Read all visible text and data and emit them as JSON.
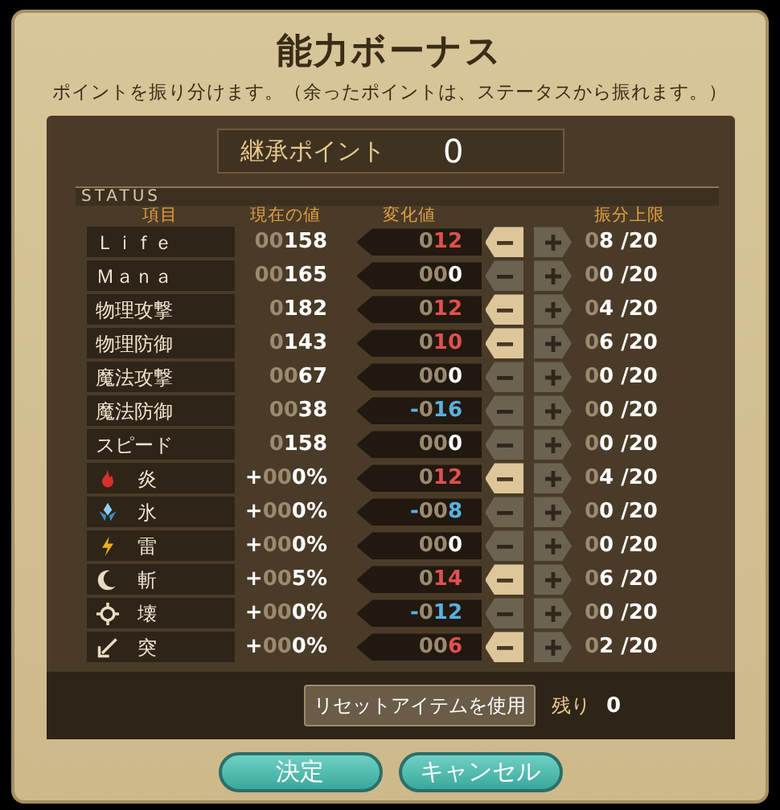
{
  "window": {
    "title": "能力ボーナス",
    "subtitle": "ポイントを振り分けます。（余ったポイントは、ステータスから振れます。）"
  },
  "inherit": {
    "label": "継承ポイント",
    "value": "0"
  },
  "section": "STATUS",
  "columns": [
    "項目",
    "現在の値",
    "変化値",
    "振分上限"
  ],
  "rows": [
    {
      "kind": "stat",
      "label": "Ｌｉｆｅ",
      "current_pad": "00",
      "current": "158",
      "change_sign": "",
      "change_pad": "0",
      "change": "12",
      "color": "#e05050",
      "minus_enabled": true,
      "limit_pad": "0",
      "limit": "8",
      "limit_max": "/20"
    },
    {
      "kind": "stat",
      "label": "Ｍａｎａ",
      "current_pad": "00",
      "current": "165",
      "change_sign": "",
      "change_pad": "00",
      "change": "0",
      "color": "#ffffff",
      "minus_enabled": false,
      "limit_pad": "0",
      "limit": "0",
      "limit_max": "/20"
    },
    {
      "kind": "stat",
      "label": "物理攻撃",
      "current_pad": "0",
      "current": "182",
      "change_sign": "",
      "change_pad": "0",
      "change": "12",
      "color": "#e05050",
      "minus_enabled": true,
      "limit_pad": "0",
      "limit": "4",
      "limit_max": "/20"
    },
    {
      "kind": "stat",
      "label": "物理防御",
      "current_pad": "0",
      "current": "143",
      "change_sign": "",
      "change_pad": "0",
      "change": "10",
      "color": "#e05050",
      "minus_enabled": true,
      "limit_pad": "0",
      "limit": "6",
      "limit_max": "/20"
    },
    {
      "kind": "stat",
      "label": "魔法攻撃",
      "current_pad": "00",
      "current": "67",
      "change_sign": "",
      "change_pad": "00",
      "change": "0",
      "color": "#ffffff",
      "minus_enabled": false,
      "limit_pad": "0",
      "limit": "0",
      "limit_max": "/20"
    },
    {
      "kind": "stat",
      "label": "魔法防御",
      "current_pad": "00",
      "current": "38",
      "change_sign": "-",
      "change_pad": "0",
      "change": "16",
      "color": "#5ab0e0",
      "minus_enabled": false,
      "limit_pad": "0",
      "limit": "0",
      "limit_max": "/20"
    },
    {
      "kind": "stat",
      "label": "スピード",
      "current_pad": "0",
      "current": "158",
      "change_sign": "",
      "change_pad": "00",
      "change": "0",
      "color": "#ffffff",
      "minus_enabled": false,
      "limit_pad": "0",
      "limit": "0",
      "limit_max": "/20"
    },
    {
      "kind": "element",
      "label": "炎",
      "current_sign": "+",
      "current_pad": "00",
      "current": "0%",
      "change_sign": "",
      "change_pad": "0",
      "change": "12",
      "color": "#e05050",
      "minus_enabled": true,
      "limit_pad": "0",
      "limit": "4",
      "limit_max": "/20"
    },
    {
      "kind": "element",
      "label": "氷",
      "current_sign": "+",
      "current_pad": "00",
      "current": "0%",
      "change_sign": "-",
      "change_pad": "00",
      "change": "8",
      "color": "#5ab0e0",
      "minus_enabled": false,
      "limit_pad": "0",
      "limit": "0",
      "limit_max": "/20"
    },
    {
      "kind": "element",
      "label": "雷",
      "current_sign": "+",
      "current_pad": "00",
      "current": "0%",
      "change_sign": "",
      "change_pad": "00",
      "change": "0",
      "color": "#ffffff",
      "minus_enabled": false,
      "limit_pad": "0",
      "limit": "0",
      "limit_max": "/20"
    },
    {
      "kind": "element",
      "label": "斬",
      "current_sign": "+",
      "current_pad": "00",
      "current": "5%",
      "change_sign": "",
      "change_pad": "0",
      "change": "14",
      "color": "#e05050",
      "minus_enabled": true,
      "limit_pad": "0",
      "limit": "6",
      "limit_max": "/20"
    },
    {
      "kind": "element",
      "label": "壊",
      "current_sign": "+",
      "current_pad": "00",
      "current": "0%",
      "change_sign": "-",
      "change_pad": "0",
      "change": "12",
      "color": "#5ab0e0",
      "minus_enabled": false,
      "limit_pad": "0",
      "limit": "0",
      "limit_max": "/20"
    },
    {
      "kind": "element",
      "label": "突",
      "current_sign": "+",
      "current_pad": "00",
      "current": "0%",
      "change_sign": "",
      "change_pad": "00",
      "change": "6",
      "color": "#e05050",
      "minus_enabled": true,
      "limit_pad": "0",
      "limit": "2",
      "limit_max": "/20"
    }
  ],
  "reset_button": "リセットアイテムを使用",
  "remaining": {
    "label": "残り",
    "value": "0"
  },
  "buttons": [
    "決定",
    "キャンセル"
  ]
}
